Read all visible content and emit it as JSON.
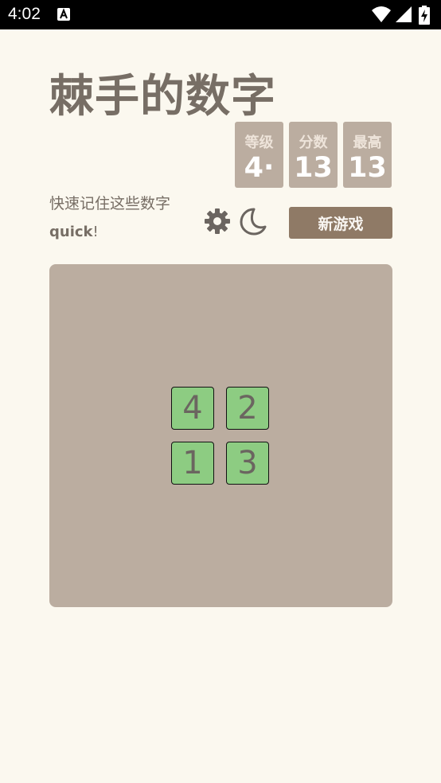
{
  "status_bar": {
    "time": "4:02",
    "icons": [
      "a-notification-icon",
      "wifi-icon",
      "cell-signal-icon",
      "battery-charging-icon"
    ]
  },
  "header": {
    "title": "棘手的数字"
  },
  "scores": {
    "level_label": "等级",
    "level_value": "4·",
    "score_label": "分数",
    "score_value": "13",
    "best_label": "最高",
    "best_value": "13"
  },
  "intro": {
    "line1": "快速记住这些数字",
    "line2_bold": "quick",
    "line2_rest": "!"
  },
  "controls": {
    "settings_icon": "gear-icon",
    "theme_icon": "moon-icon",
    "new_game_label": "新游戏"
  },
  "board": {
    "tiles": [
      "4",
      "2",
      "1",
      "3"
    ]
  },
  "colors": {
    "background": "#fbf8ef",
    "board": "#bbada0",
    "tile": "#8dcc82",
    "button": "#8f7a66",
    "text": "#776e65"
  }
}
